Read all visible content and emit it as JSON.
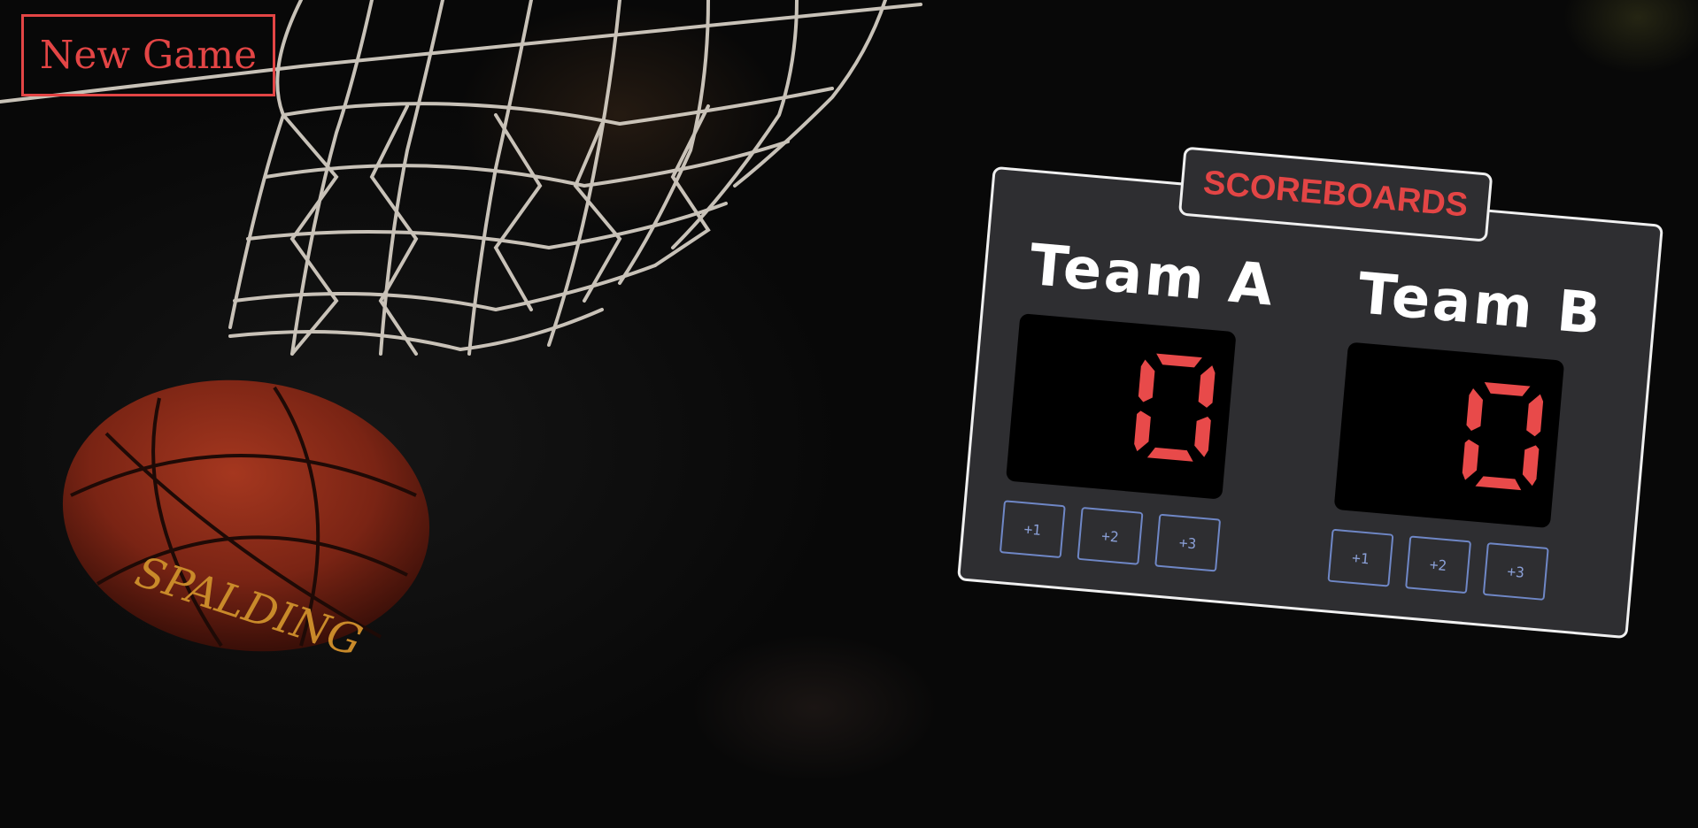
{
  "new_game": {
    "label": "New Game"
  },
  "scoreboard": {
    "title": "SCOREBOARDS",
    "teams": [
      {
        "name": "Team A",
        "score": "0",
        "buttons": [
          "+1",
          "+2",
          "+3"
        ]
      },
      {
        "name": "Team B",
        "score": "0",
        "buttons": [
          "+1",
          "+2",
          "+3"
        ]
      }
    ]
  },
  "colors": {
    "accent": "#e34545",
    "board": "#2e2e31",
    "button_border": "#6f87c6"
  },
  "icons": [
    "basketball-hoop-net-image",
    "basketball-image"
  ]
}
